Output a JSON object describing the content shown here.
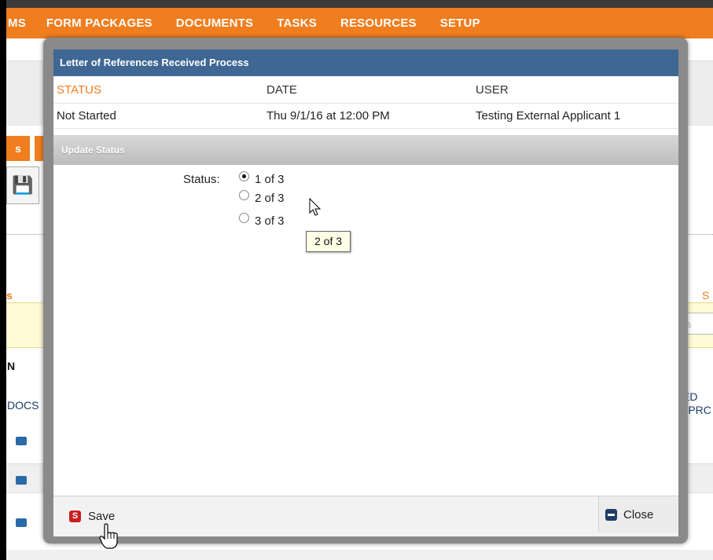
{
  "nav": {
    "items": [
      "MS",
      "FORM PACKAGES",
      "DOCUMENTS",
      "TASKS",
      "RESOURCES",
      "SETUP"
    ]
  },
  "background": {
    "tab_label": "s",
    "orange_mark": "S",
    "orange_mark_left": "s",
    "right_input_placeholder": "us",
    "docs_label": "DOCS",
    "col_label_1": "ED",
    "col_label_2": "PPRC",
    "truncated_letter": "N"
  },
  "modal": {
    "title": "Letter of References Received Process",
    "table": {
      "headers": [
        "STATUS",
        "DATE",
        "USER"
      ],
      "rows": [
        [
          "Not Started",
          "Thu 9/1/16 at 12:00 PM",
          "Testing External Applicant 1"
        ]
      ]
    },
    "update_title": "Update Status",
    "status_label": "Status:",
    "options": [
      {
        "label": "1 of 3",
        "checked": true
      },
      {
        "label": "2 of 3",
        "checked": false
      },
      {
        "label": "3 of 3",
        "checked": false
      }
    ],
    "tooltip": "2 of 3",
    "save": {
      "icon_text": "S",
      "label": "Save"
    },
    "close": {
      "label": "Close"
    }
  },
  "colors": {
    "nav_bg": "#f07d1e",
    "header_bg": "#3e6793",
    "status_header": "#f07d1e",
    "save_icon": "#c8201f",
    "close_icon": "#1f3c66"
  }
}
